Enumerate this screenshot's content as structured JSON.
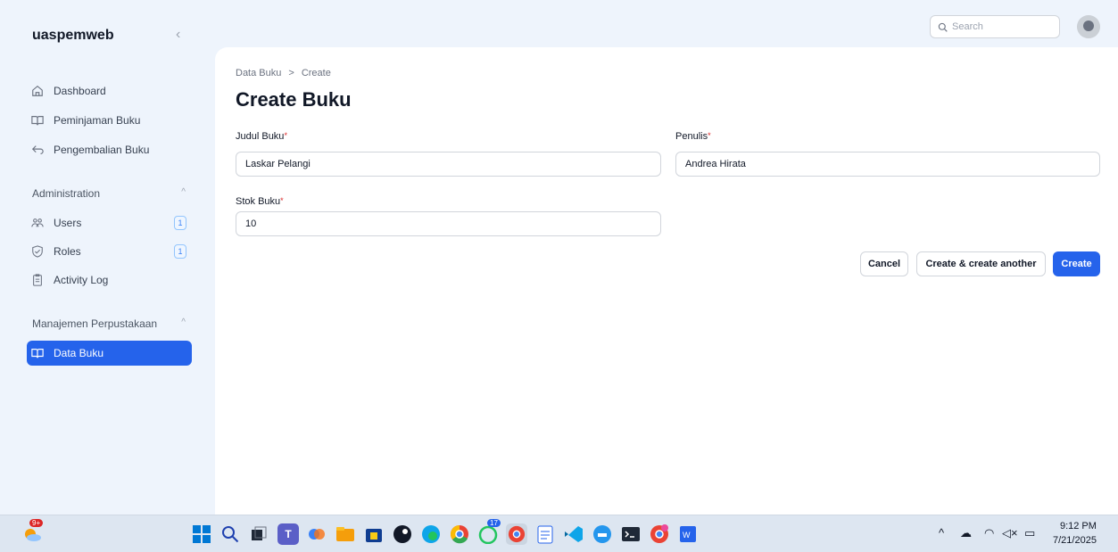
{
  "app": {
    "brand": "uaspemweb"
  },
  "sidebar": {
    "items": [
      {
        "label": "Dashboard"
      },
      {
        "label": "Peminjaman Buku"
      },
      {
        "label": "Pengembalian Buku"
      }
    ],
    "groups": [
      {
        "label": "Administration",
        "items": [
          {
            "label": "Users",
            "badge": "1"
          },
          {
            "label": "Roles",
            "badge": "1"
          },
          {
            "label": "Activity Log"
          }
        ]
      },
      {
        "label": "Manajemen Perpustakaan",
        "items": [
          {
            "label": "Data Buku"
          }
        ]
      }
    ]
  },
  "header": {
    "search_placeholder": "Search"
  },
  "breadcrumb": {
    "parent": "Data Buku",
    "separator": ">",
    "current": "Create"
  },
  "page": {
    "title": "Create Buku"
  },
  "form": {
    "judul": {
      "label": "Judul Buku",
      "value": "Laskar Pelangi"
    },
    "penulis": {
      "label": "Penulis",
      "value": "Andrea Hirata"
    },
    "stok": {
      "label": "Stok Buku",
      "value": "10"
    },
    "required_mark": "*"
  },
  "actions": {
    "cancel": "Cancel",
    "create_another": "Create & create another",
    "create": "Create"
  },
  "taskbar": {
    "weather_badge": "9+",
    "whatsapp_badge": "17",
    "clock_time": "9:12 PM",
    "clock_date": "7/21/2025"
  },
  "colors": {
    "accent": "#2563eb",
    "background": "#eef4fc"
  }
}
